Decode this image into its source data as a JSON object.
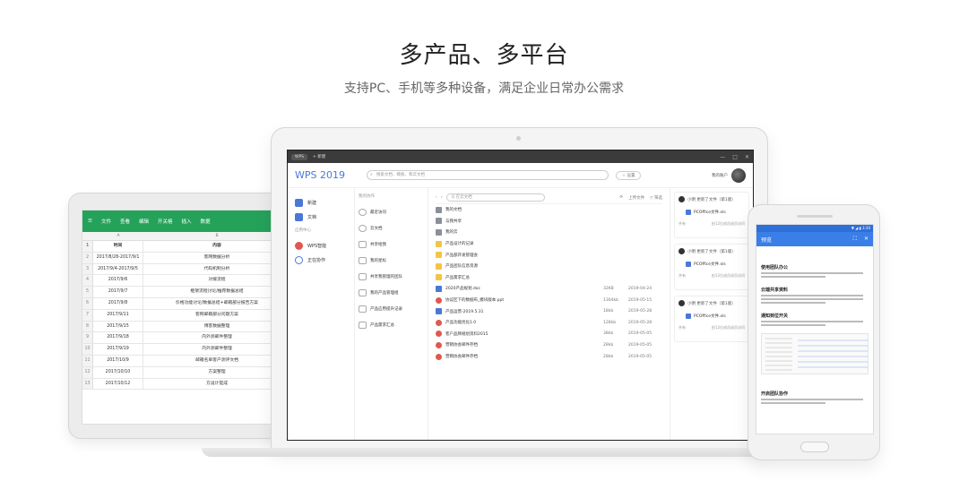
{
  "hero": {
    "title": "多产品、多平台",
    "subtitle": "支持PC、手机等多种设备，满足企业日常办公需求"
  },
  "tablet": {
    "toolbar": [
      "文件",
      "查看",
      "编辑",
      "开关格",
      "插入",
      "数据"
    ],
    "col_headers": [
      "A",
      "B"
    ],
    "rows": [
      {
        "idx": "1",
        "a": "时间",
        "b": "内容",
        "header": true
      },
      {
        "idx": "2",
        "a": "2017/8/28-2017/9/1",
        "b": "客网数据分析"
      },
      {
        "idx": "3",
        "a": "2017/9/4-2017/9/5",
        "b": "代码机制分析"
      },
      {
        "idx": "4",
        "a": "2017/9/6",
        "b": "对接流程"
      },
      {
        "idx": "5",
        "a": "2017/9/7",
        "b": "框架流程讨论/推荐数据总结"
      },
      {
        "idx": "6",
        "a": "2017/9/8",
        "b": "价格功能讨论/数据总结+邮箱部分报告方案"
      },
      {
        "idx": "7",
        "a": "2017/9/11",
        "b": "客网邮箱部分问题方案"
      },
      {
        "idx": "8",
        "a": "2017/9/15",
        "b": "博客数据整理"
      },
      {
        "idx": "9",
        "a": "2017/9/18",
        "b": "内外测邮件整理"
      },
      {
        "idx": "10",
        "a": "2017/9/19",
        "b": "内外测邮件整理"
      },
      {
        "idx": "11",
        "a": "2017/10/9",
        "b": "邮箱名单客户测评文档"
      },
      {
        "idx": "12",
        "a": "2017/10/10",
        "b": "方案整理"
      },
      {
        "idx": "13",
        "a": "2017/10/12",
        "b": "方设计提成"
      }
    ]
  },
  "laptop": {
    "tab": "WPS",
    "new_tab": "+ 新建",
    "window_controls": [
      "—",
      "□",
      "✕"
    ],
    "brand": "WPS 2019",
    "search_placeholder": "搜索文档、模板、和云文档",
    "settings": "☆ 设置",
    "user_name": "我的账户",
    "nav": [
      {
        "label": "新建",
        "icon": "new-doc-icon"
      },
      {
        "label": "文档",
        "icon": "folder-icon"
      }
    ],
    "nav_section": "应用中心",
    "nav2": [
      {
        "label": "WPS智能",
        "icon": "wps-smart-icon"
      },
      {
        "label": "正在协作",
        "icon": "collab-icon"
      }
    ],
    "col2_head": "我的协作",
    "col2": [
      "最近访问",
      "云文档",
      "共享给我",
      "我的星标",
      "共享我管理的团队",
      "我的产品管理组",
      "产品应用提升记录",
      "产品需求汇总"
    ],
    "files_toolbar": {
      "search": "Q 在云文档",
      "upload": "上传文件",
      "filter": "▽ 筛选"
    },
    "files": [
      {
        "type": "folder-dark",
        "name": "我的文档",
        "size": "",
        "date": ""
      },
      {
        "type": "folder-dark",
        "name": "与我共享",
        "size": "",
        "date": ""
      },
      {
        "type": "folder-dark",
        "name": "我的云",
        "size": "",
        "date": ""
      },
      {
        "type": "folder",
        "name": "产品设计的记录",
        "size": "",
        "date": ""
      },
      {
        "type": "folder",
        "name": "产品部开发管理会",
        "size": "",
        "date": ""
      },
      {
        "type": "folder",
        "name": "产品团队信息资源",
        "size": "",
        "date": ""
      },
      {
        "type": "folder",
        "name": "产品需求汇总",
        "size": "",
        "date": ""
      },
      {
        "type": "doc",
        "name": "2020产品规划.doc",
        "size": "32KB",
        "date": "2019-04-24"
      },
      {
        "type": "pdf",
        "name": "协议区下的数据布_模块版本.ppt",
        "size": "1304kb",
        "date": "2019-05-15"
      },
      {
        "type": "doc",
        "name": "产品运营-2019.5.31",
        "size": "18kb",
        "date": "2019-05-28"
      },
      {
        "type": "pdf",
        "name": "产品功能优化1.0",
        "size": "128kb",
        "date": "2019-05-28"
      },
      {
        "type": "pdf",
        "name": "客户品牌规划资料2015",
        "size": "38kb",
        "date": "2019-05-05"
      },
      {
        "type": "pdf",
        "name": "营销协会邮件存档",
        "size": "28kb",
        "date": "2019-05-05"
      },
      {
        "type": "pdf",
        "name": "营销协会邮件存档",
        "size": "28kb",
        "date": "2019-05-05"
      }
    ],
    "activity": [
      {
        "who": "小明 更新了文件（第1版）",
        "file": "PCOffice文件.xls",
        "left": "共有",
        "right": "由12位成员成员访问"
      },
      {
        "who": "小明 更新了文件（第1版）",
        "file": "PCOffice文件.xls",
        "left": "共有",
        "right": "由12位成员成员访问"
      },
      {
        "who": "小明 更新了文件（第1版）",
        "file": "PCOffice文件.xls",
        "left": "共有",
        "right": "由12位成员成员访问"
      }
    ]
  },
  "phone": {
    "status": "▼ ◢ ▮ 3:30",
    "title": "预览",
    "sections": [
      "使用团队办公",
      "云端共享资料",
      "通知到位开关"
    ],
    "footer_heading": "开启团队协作"
  },
  "colors": {
    "wps_blue": "#4a78d8",
    "et_green": "#25a25a",
    "phone_blue": "#3a7ee8",
    "folder_yellow": "#f4c448",
    "pdf_red": "#e0584f"
  }
}
